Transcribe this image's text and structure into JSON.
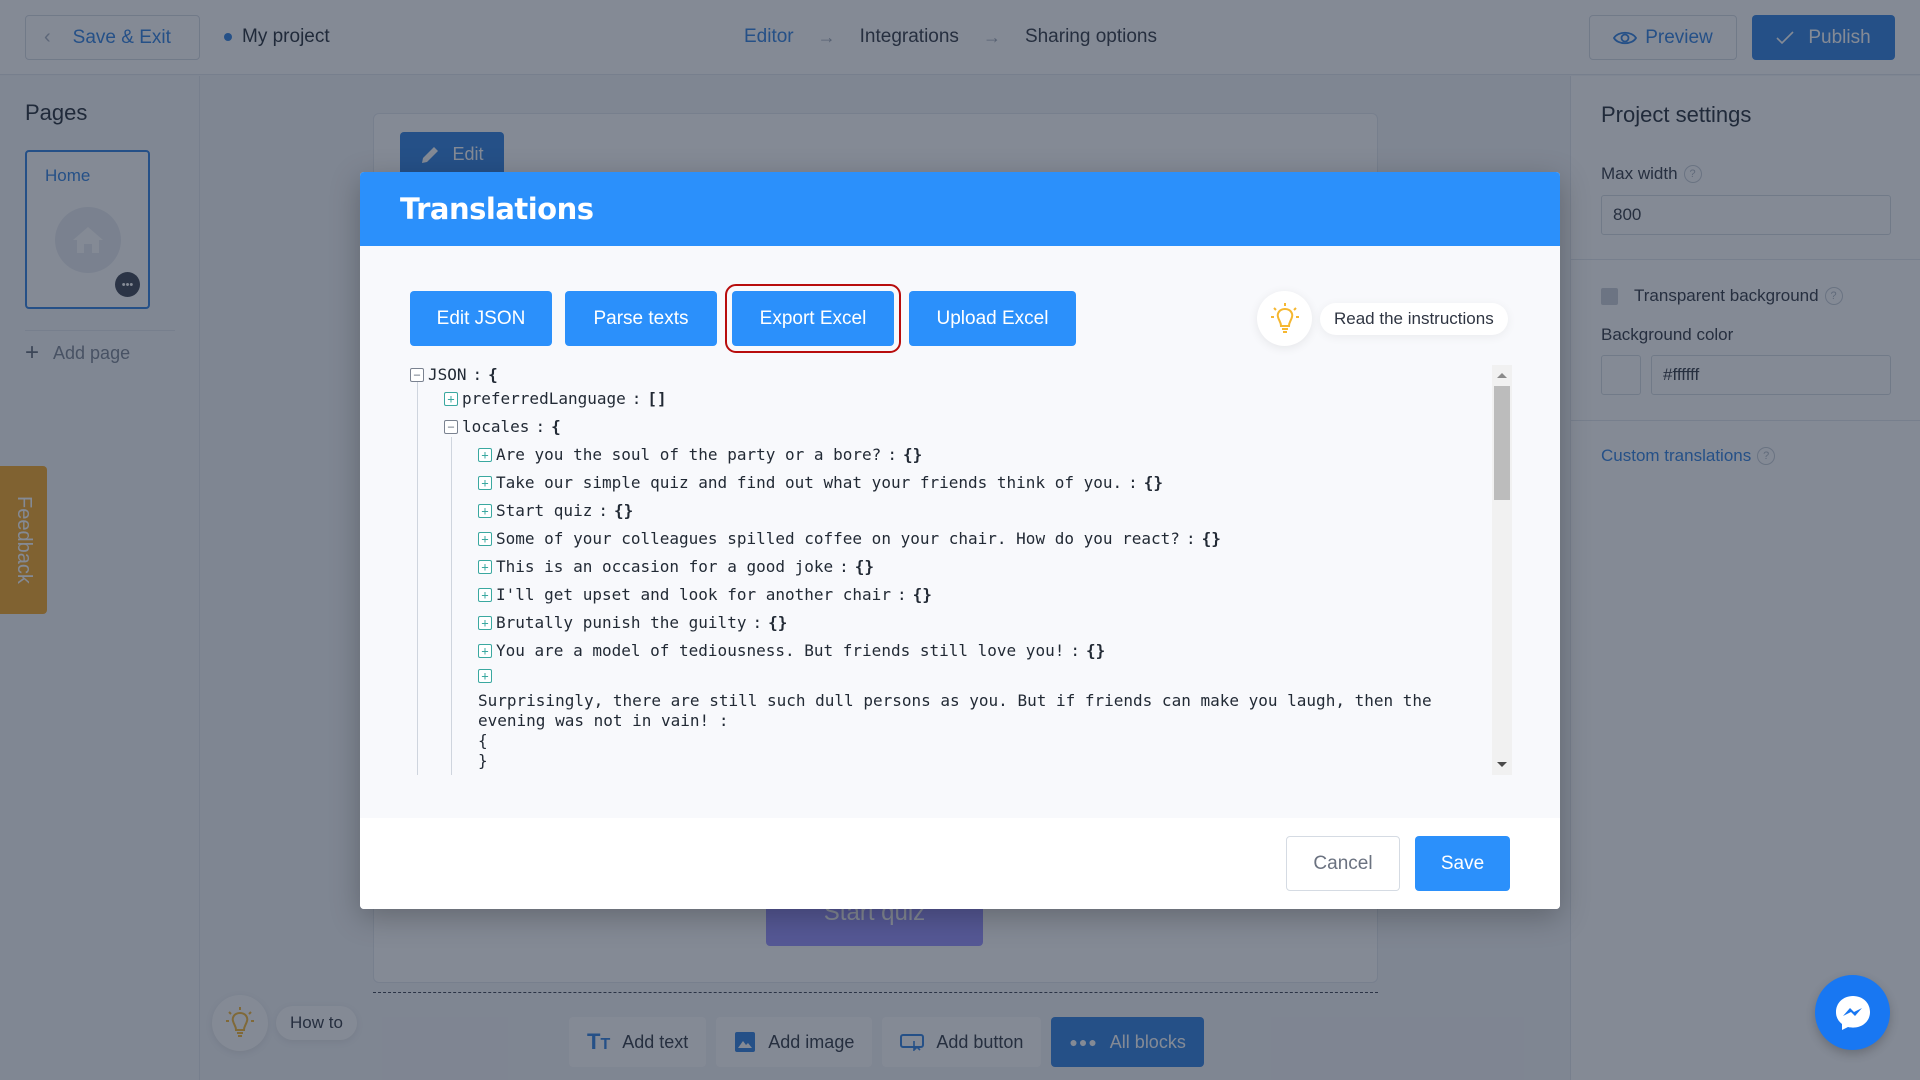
{
  "topbar": {
    "save_exit_label": "Save & Exit",
    "project_name": "My project",
    "steps": [
      {
        "label": "Editor",
        "active": true
      },
      {
        "label": "Integrations",
        "active": false
      },
      {
        "label": "Sharing options",
        "active": false
      }
    ],
    "preview_label": "Preview",
    "publish_label": "Publish"
  },
  "left_sidebar": {
    "title": "Pages",
    "pages": [
      {
        "label": "Home",
        "selected": true
      }
    ],
    "add_page_label": "Add page"
  },
  "feedback_label": "Feedback",
  "howto_label": "How to",
  "canvas": {
    "edit_label": "Edit",
    "start_quiz_label": "Start quiz",
    "blocks": [
      {
        "label": "Add text",
        "icon": "text-icon"
      },
      {
        "label": "Add image",
        "icon": "image-icon"
      },
      {
        "label": "Add button",
        "icon": "button-icon"
      },
      {
        "label": "All blocks",
        "icon": "more-dots-icon"
      }
    ]
  },
  "right_sidebar": {
    "title": "Project settings",
    "max_width_label": "Max width",
    "max_width_value": "800",
    "transparent_bg_label": "Transparent background",
    "transparent_bg_checked": false,
    "bg_color_label": "Background color",
    "bg_color_value": "#ffffff",
    "custom_translations_label": "Custom translations"
  },
  "modal": {
    "title": "Translations",
    "actions": [
      {
        "label": "Edit JSON",
        "highlighted": false
      },
      {
        "label": "Parse texts",
        "highlighted": false
      },
      {
        "label": "Export Excel",
        "highlighted": true
      },
      {
        "label": "Upload Excel",
        "highlighted": false
      }
    ],
    "instructions_label": "Read the instructions",
    "tree": {
      "root_key": "JSON",
      "root_open": "{",
      "preferred_language_key": "preferredLanguage",
      "preferred_language_value": "[]",
      "locales_key": "locales",
      "locales_open": "{",
      "locale_entries": [
        {
          "key": "Are you the soul of the party or a bore?",
          "value": "{}"
        },
        {
          "key": "Take our simple quiz and find out what your friends think of you.",
          "value": "{}"
        },
        {
          "key": "Start quiz",
          "value": "{}"
        },
        {
          "key": "Some of your colleagues spilled coffee on your chair. How do you react?",
          "value": "{}"
        },
        {
          "key": "This is an occasion for a good joke",
          "value": "{}"
        },
        {
          "key": "I'll get upset and look for another chair",
          "value": "{}"
        },
        {
          "key": "Brutally punish the guilty",
          "value": "{}"
        },
        {
          "key": "You are a model of tediousness. But friends still love you!",
          "value": "{}"
        }
      ],
      "wrapped_entry": {
        "key": "Surprisingly, there are still such dull persons as you. But if friends can make you laugh, then the evening was not in vain!",
        "open": "{",
        "close": "}"
      }
    },
    "cancel_label": "Cancel",
    "save_label": "Save"
  },
  "colors": {
    "brand_blue": "#2d7fe0",
    "modal_blue": "#2b90fb",
    "highlight_red": "#b80d0d",
    "feedback_orange": "#f5a623",
    "messenger_blue": "#1877f2"
  }
}
